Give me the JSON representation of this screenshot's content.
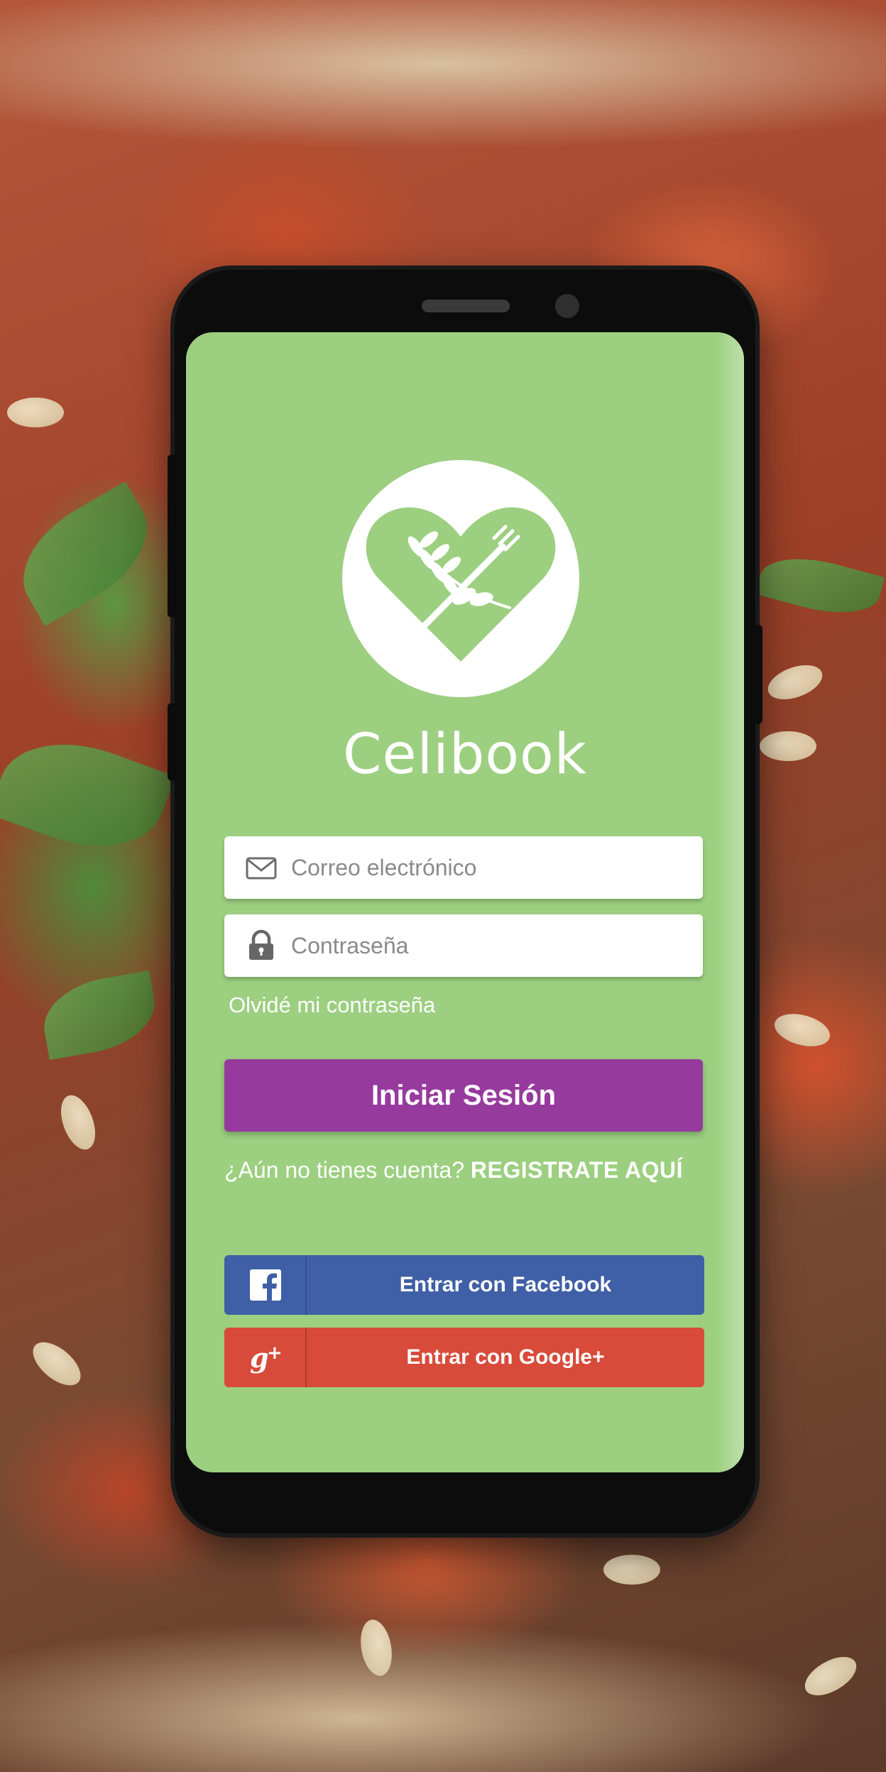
{
  "app": {
    "name": "Celibook"
  },
  "login_form": {
    "email_placeholder": "Correo electrónico",
    "password_placeholder": "Contraseña",
    "forgot_password": "Olvidé mi contraseña",
    "submit_label": "Iniciar Sesión"
  },
  "register": {
    "prompt": "¿Aún no tienes cuenta? ",
    "link": "REGISTRATE AQUÍ"
  },
  "social": {
    "facebook_label": "Entrar con Facebook",
    "google_label": "Entrar con Google+"
  },
  "icons": {
    "logo": "heart-wheat-fork-icon",
    "email": "envelope-icon",
    "password": "padlock-icon",
    "facebook": "facebook-icon",
    "google": "google-plus-icon"
  },
  "colors": {
    "screen_bg": "#9ccf80",
    "primary_button": "#973a9e",
    "facebook": "#3f5fa6",
    "google": "#d84a3a"
  }
}
